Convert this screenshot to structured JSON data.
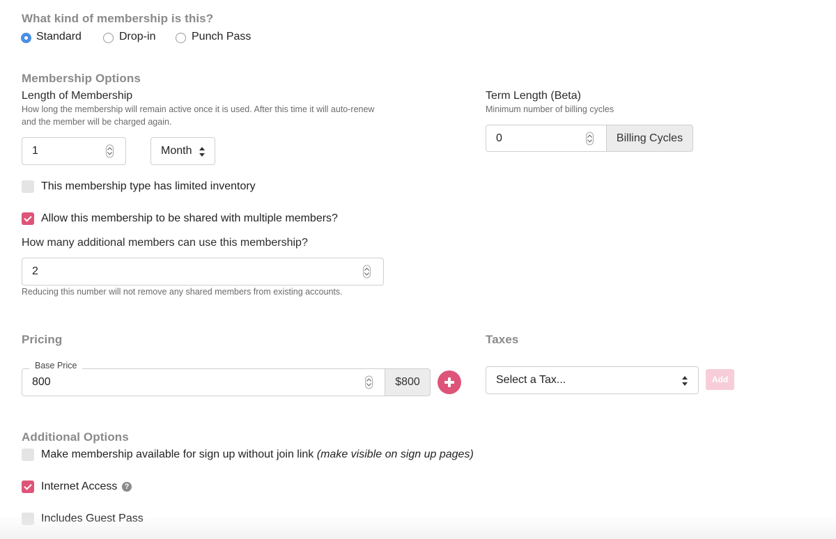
{
  "membership_kind": {
    "title": "What kind of membership is this?",
    "options": [
      {
        "label": "Standard",
        "selected": true
      },
      {
        "label": "Drop-in",
        "selected": false
      },
      {
        "label": "Punch Pass",
        "selected": false
      }
    ]
  },
  "membership_options": {
    "title": "Membership Options",
    "length": {
      "label": "Length of Membership",
      "help_line1": "How long the membership will remain active once it is used. After this time it will auto-renew",
      "help_line2": "and the member will be charged again.",
      "value": "1",
      "unit": "Month"
    },
    "term": {
      "label": "Term Length (Beta)",
      "help": "Minimum number of billing cycles",
      "value": "0",
      "addon": "Billing Cycles"
    },
    "limited_inventory": {
      "label": "This membership type has limited inventory",
      "checked": false
    },
    "shared": {
      "label": "Allow this membership to be shared with multiple members?",
      "checked": true
    },
    "additional_members": {
      "question": "How many additional members can use this membership?",
      "value": "2",
      "help": "Reducing this number will not remove any shared members from existing accounts."
    }
  },
  "pricing": {
    "title": "Pricing",
    "base_price_label": "Base Price",
    "base_price_value": "800",
    "base_price_display": "$800"
  },
  "taxes": {
    "title": "Taxes",
    "select_placeholder": "Select a Tax...",
    "add_label": "Add"
  },
  "additional_options": {
    "title": "Additional Options",
    "signup": {
      "label": "Make membership available for sign up without join link",
      "note": "(make visible on sign up pages)",
      "checked": false
    },
    "internet": {
      "label": "Internet Access",
      "checked": true
    },
    "guest_pass": {
      "label": "Includes Guest Pass",
      "checked": false
    }
  },
  "colors": {
    "accent": "#de5478",
    "radio_selected": "#4a90e2"
  }
}
